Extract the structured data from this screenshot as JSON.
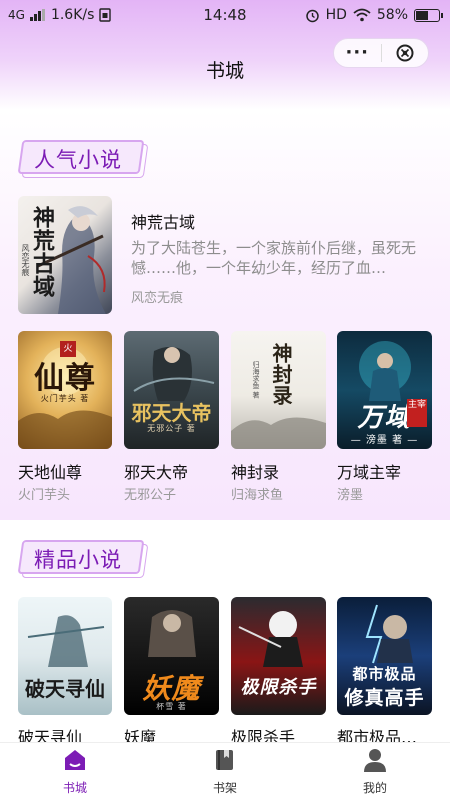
{
  "status": {
    "network": "4G",
    "speed": "1.6K/s",
    "time": "14:48",
    "hd": "HD",
    "battery": "58%",
    "battery_level": 0.58
  },
  "header": {
    "title": "书城",
    "more_icon": "more-dots-icon",
    "close_icon": "circle-close-icon"
  },
  "popular": {
    "title": "人气小说",
    "featured": {
      "name": "神荒古域",
      "desc": "为了大陆苍生，一个家族前仆后继，虽死无憾……他，一个年幼少年，经历了血…",
      "author": "风恋无痕",
      "cover_text": "神荒古域",
      "cover_sub": "风恋无痕"
    },
    "books": [
      {
        "name": "天地仙尊",
        "author": "火门芋头",
        "cover_text": "仙尊",
        "cover_sub": "火门芋头 著"
      },
      {
        "name": "邪天大帝",
        "author": "无邪公子",
        "cover_text": "邪天大帝",
        "cover_sub": "无邪公子 著"
      },
      {
        "name": "神封录",
        "author": "归海求鱼",
        "cover_text": "神封录",
        "cover_sub": "归海求鱼 著"
      },
      {
        "name": "万域主宰",
        "author": "滂墨",
        "cover_text": "万域",
        "cover_sub": "— 滂墨 著 —",
        "cover_badge": "主宰"
      }
    ]
  },
  "premium": {
    "title": "精品小说",
    "books": [
      {
        "name": "破天寻仙",
        "cover_text": "破天寻仙"
      },
      {
        "name": "妖魔",
        "cover_text": "妖魔",
        "cover_sub": "杯雪 著"
      },
      {
        "name": "极限杀手",
        "cover_text": "极限杀手"
      },
      {
        "name": "都市极品…",
        "cover_text": "都市极品",
        "cover_text2": "修真高手"
      }
    ]
  },
  "tabs": [
    {
      "label": "书城",
      "icon": "home-icon",
      "active": true
    },
    {
      "label": "书架",
      "icon": "bookshelf-icon",
      "active": false
    },
    {
      "label": "我的",
      "icon": "user-icon",
      "active": false
    }
  ],
  "colors": {
    "accent": "#7c1cb5",
    "header_gradient_top": "#e3b4f6"
  }
}
